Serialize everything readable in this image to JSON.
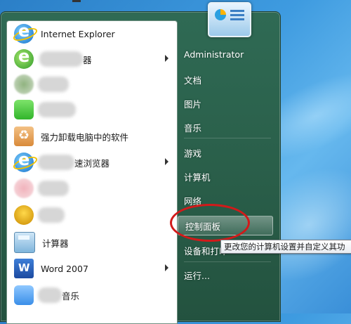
{
  "left_menu": {
    "items": [
      {
        "label": "Internet Explorer",
        "icon": "internet-explorer-icon",
        "arrow": false
      },
      {
        "label": "器",
        "icon": "browser-icon-green",
        "arrow": true
      },
      {
        "label": "",
        "icon": "app-icon-blurred",
        "arrow": false
      },
      {
        "label": "",
        "icon": "app-icon-green",
        "arrow": false
      },
      {
        "label": "强力卸载电脑中的软件",
        "icon": "uninstaller-icon",
        "arrow": false
      },
      {
        "label": "速浏览器",
        "icon": "ie-browser-icon",
        "arrow": true
      },
      {
        "label": "",
        "icon": "app-icon-pink",
        "arrow": false
      },
      {
        "label": "",
        "icon": "gold-figure-icon",
        "arrow": false
      },
      {
        "label": "计算器",
        "icon": "calculator-icon",
        "arrow": false
      },
      {
        "label": "Word 2007",
        "icon": "word-icon",
        "arrow": true
      },
      {
        "label": "音乐",
        "icon": "music-app-icon",
        "arrow": false
      }
    ]
  },
  "right_menu": {
    "user": "Administrator",
    "items": [
      "文档",
      "图片",
      "音乐",
      "游戏",
      "计算机",
      "网络",
      "控制面板",
      "设备和打印",
      "运行..."
    ]
  },
  "tooltip": "更改您的计算机设置并自定义其功",
  "colors": {
    "annotation": "#d21a1a",
    "menu_green": "#2a5f4a"
  }
}
